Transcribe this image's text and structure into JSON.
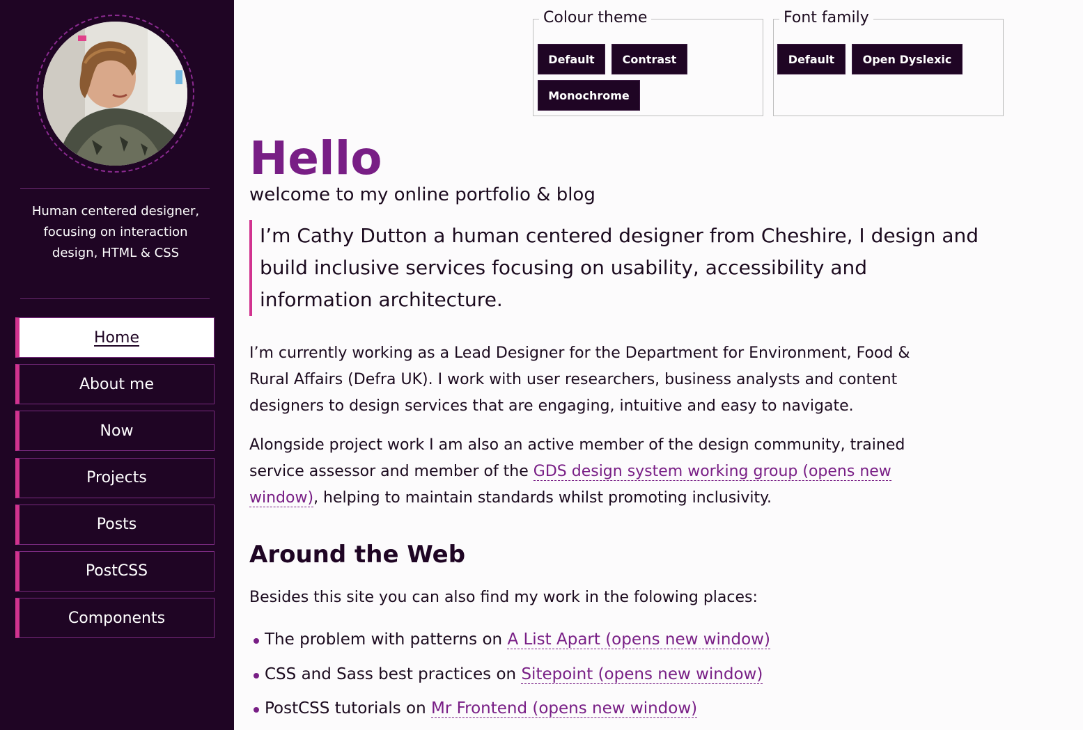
{
  "sidebar": {
    "avatar_alt": "Photo of Cathy Dutton",
    "tagline": "Human centered designer, focusing on interaction design, HTML & CSS",
    "nav": [
      {
        "label": "Home",
        "active": true
      },
      {
        "label": "About me"
      },
      {
        "label": "Now"
      },
      {
        "label": "Projects"
      },
      {
        "label": "Posts"
      },
      {
        "label": "PostCSS"
      },
      {
        "label": "Components"
      }
    ]
  },
  "preferences": {
    "colour_theme": {
      "legend": "Colour theme",
      "buttons": [
        "Default",
        "Contrast",
        "Monochrome"
      ]
    },
    "font_family": {
      "legend": "Font family",
      "buttons": [
        "Default",
        "Open Dyslexic"
      ]
    }
  },
  "main": {
    "title": "Hello",
    "subtitle": "welcome to my online portfolio & blog",
    "intro": "I’m Cathy Dutton a human centered designer from Cheshire, I design and build inclusive services focusing on usability, accessibility and information architecture.",
    "para1": "I’m currently working as a Lead Designer for the Department for Environment, Food & Rural Affairs (Defra UK). I work with user researchers, business analysts and content designers to design services that are engaging, intuitive and easy to navigate.",
    "para2_before": "Alongside project work I am also an active member of the design community, trained service assessor and member of the ",
    "para2_link": "GDS design system working group (opens new window)",
    "para2_after": ", helping to maintain standards whilst promoting inclusivity.",
    "section_heading": "Around the Web",
    "section_intro": "Besides this site you can also find my work in the folowing places:",
    "links": [
      {
        "text": "The problem with patterns on ",
        "link": "A List Apart (opens new window)"
      },
      {
        "text": "CSS and Sass best practices on ",
        "link": "Sitepoint (opens new window)"
      },
      {
        "text": "PostCSS tutorials on ",
        "link": "Mr Frontend (opens new window)"
      }
    ]
  },
  "colors": {
    "sidebar_bg": "#1f0524",
    "accent": "#781e85",
    "nav_border_accent": "#d1338f",
    "page_bg": "#fcfbfc"
  }
}
